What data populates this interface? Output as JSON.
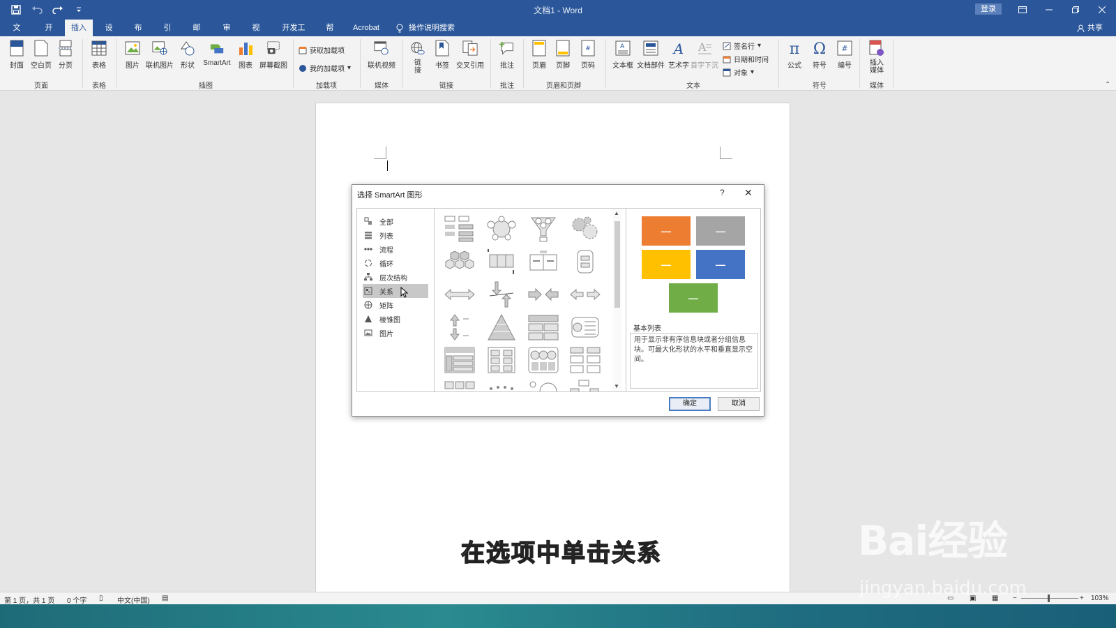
{
  "window": {
    "title": "文档1 - Word",
    "login_label": "登录"
  },
  "menu": {
    "tabs": [
      "文件",
      "开始",
      "插入",
      "设计",
      "布局",
      "引用",
      "邮件",
      "审阅",
      "视图",
      "开发工具",
      "帮助",
      "Acrobat"
    ],
    "active_tab": "插入",
    "search_label": "操作说明搜索",
    "share_label": "共享"
  },
  "ribbon": {
    "buttons": {
      "cover": "封面",
      "blank_page": "空白页",
      "page_break": "分页",
      "table": "表格",
      "picture": "图片",
      "online_picture": "联机图片",
      "shapes": "形状",
      "smartart": "SmartArt",
      "chart": "图表",
      "screenshot": "屏幕截图",
      "get_addins": "获取加载项",
      "my_addins": "我的加载项",
      "online_video": "联机视频",
      "link": "链\n接",
      "bookmark": "书签",
      "cross_ref": "交叉引用",
      "comment": "批注",
      "header": "页眉",
      "footer": "页脚",
      "page_number": "页码",
      "textbox": "文本框",
      "quick_parts": "文档部件",
      "wordart": "艺术字",
      "drop_cap": "首字下沉",
      "signature_line": "签名行",
      "date_time": "日期和时间",
      "object": "对象",
      "equation": "公式",
      "symbol": "符号",
      "numbering": "编号",
      "insert_media": "插入\n媒体"
    },
    "groups": {
      "pages": "页面",
      "tables": "表格",
      "illustrations": "插图",
      "addins": "加载项",
      "media": "媒体",
      "links": "链接",
      "comments": "批注",
      "header_footer": "页眉和页脚",
      "text": "文本",
      "symbols": "符号",
      "media2": "媒体"
    }
  },
  "dialog": {
    "title": "选择 SmartArt 图形",
    "help": "?",
    "categories": [
      {
        "label": "全部",
        "icon": "all-icon"
      },
      {
        "label": "列表",
        "icon": "list-icon"
      },
      {
        "label": "流程",
        "icon": "process-icon"
      },
      {
        "label": "循环",
        "icon": "cycle-icon"
      },
      {
        "label": "层次结构",
        "icon": "hierarchy-icon"
      },
      {
        "label": "关系",
        "icon": "relationship-icon"
      },
      {
        "label": "矩阵",
        "icon": "matrix-icon"
      },
      {
        "label": "棱锥图",
        "icon": "pyramid-icon"
      },
      {
        "label": "图片",
        "icon": "picture-icon"
      }
    ],
    "selected_category": "关系",
    "preview_title": "基本列表",
    "preview_description": "用于显示非有序信息块或者分组信息块。可最大化形状的水平和垂直显示空间。",
    "preview_colors": [
      "#ed7d31",
      "#a5a5a5",
      "#ffc000",
      "#4472c4",
      "#70ad47"
    ],
    "ok_label": "确定",
    "cancel_label": "取消"
  },
  "caption": "在选项中单击关系",
  "status": {
    "page_info": "第 1 页，共 1 页",
    "word_count": "0 个字",
    "language": "中文(中国)",
    "zoom": "103%"
  },
  "watermark": {
    "brand": "Bai经验",
    "url": "jingyan.baidu.com"
  }
}
